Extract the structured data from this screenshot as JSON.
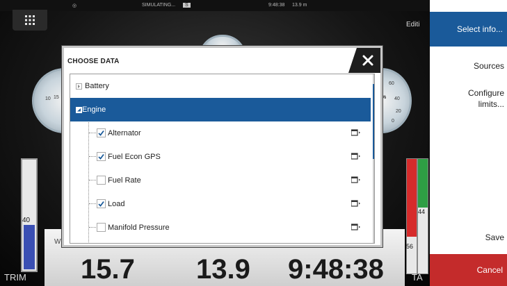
{
  "status_bar": {
    "app_status": "SIMULATING...",
    "chip_text": "S",
    "time": "9:48:38",
    "value": "13.9 m"
  },
  "edit_label": "Editi",
  "gauges": {
    "left_ticks": [
      "10",
      "15"
    ],
    "right_ticks": [
      "%",
      "40",
      "60",
      "20",
      "0"
    ]
  },
  "trim": {
    "value": "40",
    "label": "TRIM",
    "level": 0.4
  },
  "tabs": {
    "left_value": "56",
    "right_value": "44",
    "label": "TA",
    "left_color": "#d62b2b",
    "right_color": "#2e9e44"
  },
  "bottom": {
    "small_label": "WT",
    "values": [
      "15.7",
      "13.9",
      "9:48:38"
    ]
  },
  "dialog": {
    "title": "CHOOSE DATA",
    "rows": [
      {
        "label": "Battery",
        "type": "group",
        "expanded": false
      },
      {
        "label": "Engine",
        "type": "group",
        "expanded": true,
        "selected": true
      },
      {
        "label": "Alternator",
        "checked": true
      },
      {
        "label": "Fuel Econ GPS",
        "checked": true
      },
      {
        "label": "Fuel Rate",
        "checked": false
      },
      {
        "label": "Load",
        "checked": true
      },
      {
        "label": "Manifold Pressure",
        "checked": false
      }
    ]
  },
  "side_menu": {
    "header": "Select info...",
    "items": [
      "Sources",
      "Configure\nlimits..."
    ],
    "save": "Save",
    "cancel": "Cancel"
  }
}
